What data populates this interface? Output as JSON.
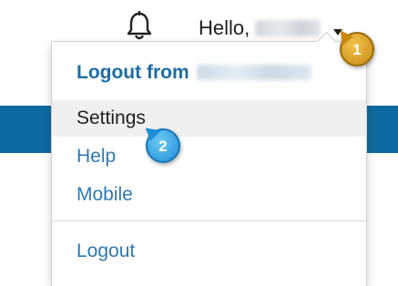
{
  "colors": {
    "accent": "#0f6a9f",
    "heading": "#1d6da3",
    "link": "#2e7ab6"
  },
  "header": {
    "bell_icon": "bell-icon",
    "greeting": "Hello,",
    "caret_icon": "caret-down-icon"
  },
  "menu": {
    "title": "Logout from",
    "items": [
      {
        "label": "Settings",
        "active": true
      },
      {
        "label": "Help",
        "active": false
      },
      {
        "label": "Mobile",
        "active": false
      }
    ],
    "logout_label": "Logout"
  },
  "callouts": [
    {
      "number": "1"
    },
    {
      "number": "2"
    }
  ]
}
